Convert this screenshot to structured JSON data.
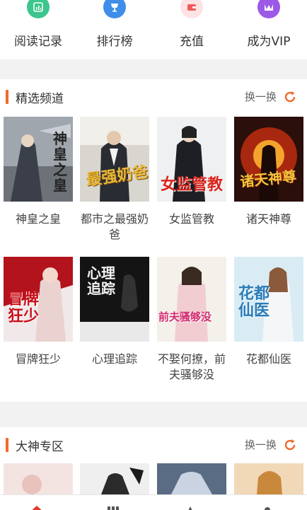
{
  "quick_entries": [
    {
      "label": "阅读记录",
      "icon": "reading-history-icon",
      "color": "#3cc58c"
    },
    {
      "label": "排行榜",
      "icon": "ranking-icon",
      "color": "#3f8ee8"
    },
    {
      "label": "充值",
      "icon": "recharge-icon",
      "color": "#f05a5a"
    },
    {
      "label": "成为VIP",
      "icon": "vip-icon",
      "color": "#9b59e6"
    }
  ],
  "sections": [
    {
      "title": "精选频道",
      "refresh_label": "换一换",
      "books": [
        {
          "title": "神皇之皇",
          "cover_text": "神皇之皇"
        },
        {
          "title": "都市之最强奶爸",
          "cover_text": "最强奶爸"
        },
        {
          "title": "女监管教",
          "cover_text": "女监管教"
        },
        {
          "title": "诸天神尊",
          "cover_text": "诸天神尊"
        },
        {
          "title": "冒牌狂少",
          "cover_text": "冒牌狂少"
        },
        {
          "title": "心理追踪",
          "cover_text": "心理追踪"
        },
        {
          "title": "不娶何撩，前夫骚够没",
          "cover_text": "前夫骚够没"
        },
        {
          "title": "花都仙医",
          "cover_text": "花都仙医"
        }
      ]
    },
    {
      "title": "大神专区",
      "refresh_label": "换一换"
    }
  ],
  "accent_color": "#f06a2a",
  "bottom_nav": [
    {
      "icon": "home-icon",
      "active": true
    },
    {
      "icon": "bookshelf-icon",
      "active": false
    },
    {
      "icon": "category-icon",
      "active": false
    },
    {
      "icon": "profile-icon",
      "active": false
    }
  ]
}
